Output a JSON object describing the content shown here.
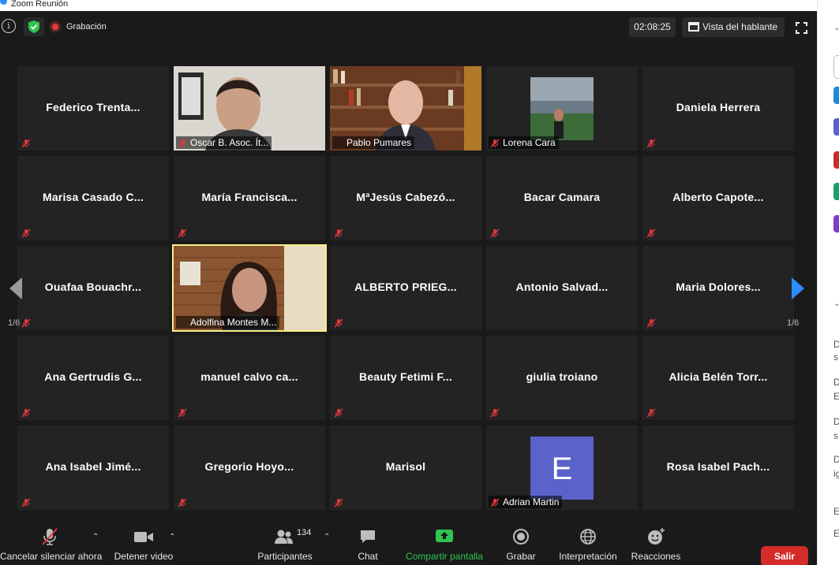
{
  "window": {
    "title": "Zoom Reunión"
  },
  "topbar": {
    "recording_label": "Grabación",
    "timer": "02:08:25",
    "view_label": "Vista del hablante"
  },
  "participants": [
    {
      "name": "Federico  Trenta...",
      "video": false,
      "muted": true
    },
    {
      "name": "Oscar B. Asoc. Ít...",
      "video": true,
      "muted": true,
      "scene": "wall"
    },
    {
      "name": "Pablo Pumares",
      "video": true,
      "muted": false,
      "scene": "bookshelf"
    },
    {
      "name": "Lorena Cara",
      "video": true,
      "muted": true,
      "scene": "stadium"
    },
    {
      "name": "Daniela Herrera",
      "video": false,
      "muted": true
    },
    {
      "name": "Marisa Casado C...",
      "video": false,
      "muted": true
    },
    {
      "name": "María  Francisca...",
      "video": false,
      "muted": true
    },
    {
      "name": "MªJesús  Cabezó...",
      "video": false,
      "muted": true
    },
    {
      "name": "Bacar Camara",
      "video": false,
      "muted": true
    },
    {
      "name": "Alberto  Capote...",
      "video": false,
      "muted": true
    },
    {
      "name": "Ouafaa  Bouachr...",
      "video": false,
      "muted": true
    },
    {
      "name": "Adolfina Montes M...",
      "video": true,
      "muted": false,
      "active": true,
      "scene": "brick"
    },
    {
      "name": "ALBERTO PRIEG...",
      "video": false,
      "muted": true
    },
    {
      "name": "Antonio  Salvad...",
      "video": false,
      "muted": false
    },
    {
      "name": "Maria  Dolores...",
      "video": false,
      "muted": true
    },
    {
      "name": "Ana Gertrudis G...",
      "video": false,
      "muted": true
    },
    {
      "name": "manuel  calvo  ca...",
      "video": false,
      "muted": true
    },
    {
      "name": "Beauty Fetimi F...",
      "video": false,
      "muted": true
    },
    {
      "name": "giulia troiano",
      "video": false,
      "muted": true
    },
    {
      "name": "Alicia Belén  Torr...",
      "video": false,
      "muted": true
    },
    {
      "name": "Ana Isabel Jimé...",
      "video": false,
      "muted": true
    },
    {
      "name": "Gregorio  Hoyo...",
      "video": false,
      "muted": true
    },
    {
      "name": "Marisol",
      "video": false,
      "muted": true
    },
    {
      "name": "Adrian Martin",
      "video": true,
      "muted": true,
      "scene": "avatar",
      "avatar_letter": "E"
    },
    {
      "name": "Rosa Isabel Pach...",
      "video": false,
      "muted": false
    }
  ],
  "pager": {
    "left": "1/6",
    "right": "1/6"
  },
  "toolbar": {
    "mute_label": "Cancelar silenciar ahora",
    "video_label": "Detener video",
    "participants_label": "Participantes",
    "participants_count": "134",
    "chat_label": "Chat",
    "share_label": "Compartir pantalla",
    "record_label": "Grabar",
    "interpret_label": "Interpretación",
    "reactions_label": "Reacciones",
    "leave_label": "Salir"
  },
  "sidepanel": {
    "snippets": [
      "D",
      "s",
      "D",
      "E",
      "D",
      "s",
      "D",
      "ig",
      "Er",
      "Es"
    ]
  },
  "colors": {
    "accent_green": "#2ec451",
    "leave_red": "#d42b2b",
    "muted_red": "#e0383e",
    "active_border": "#f6f08a",
    "avatar_purple": "#5b62c9"
  }
}
